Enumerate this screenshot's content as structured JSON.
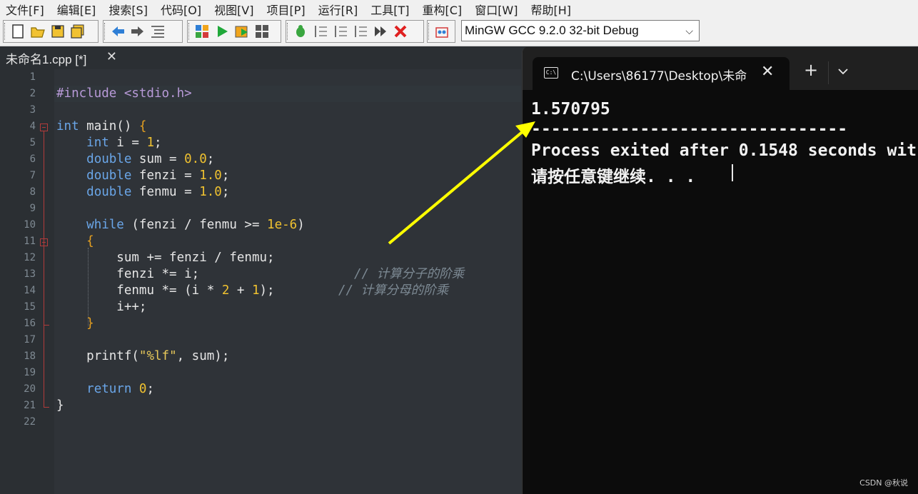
{
  "menu": [
    "文件[F]",
    "编辑[E]",
    "搜索[S]",
    "代码[O]",
    "视图[V]",
    "项目[P]",
    "运行[R]",
    "工具[T]",
    "重构[C]",
    "窗口[W]",
    "帮助[H]"
  ],
  "toolbar": {
    "compiler": "MinGW GCC 9.2.0 32-bit Debug"
  },
  "editor": {
    "tab_title": "未命名1.cpp [*]",
    "tab_close": "✕",
    "line_numbers": [
      "1",
      "2",
      "3",
      "4",
      "5",
      "6",
      "7",
      "8",
      "9",
      "10",
      "11",
      "12",
      "13",
      "14",
      "15",
      "16",
      "17",
      "18",
      "19",
      "20",
      "21",
      "22"
    ],
    "code": {
      "l2_pp": "#include <stdio.h>",
      "l4_kw": "int",
      "l4_rest": " main() ",
      "l4_brace": "{",
      "l5_kw": "int",
      "l5_rest": " i = ",
      "l5_num": "1",
      "l5_end": ";",
      "l6_kw": "double",
      "l6_rest": " sum = ",
      "l6_num": "0.0",
      "l6_end": ";",
      "l7_kw": "double",
      "l7_rest": " fenzi = ",
      "l7_num": "1.0",
      "l7_end": ";",
      "l8_kw": "double",
      "l8_rest": " fenmu = ",
      "l8_num": "1.0",
      "l8_end": ";",
      "l10_kw": "while",
      "l10_rest": " (fenzi / fenmu >= ",
      "l10_num": "1e-6",
      "l10_end": ")",
      "l11_brace": "{",
      "l12": "sum += fenzi / fenmu;",
      "l13": "fenzi *= i;",
      "l13_cmt": "// 计算分子的阶乘",
      "l14_a": "fenmu *= (i * ",
      "l14_num1": "2",
      "l14_b": " + ",
      "l14_num2": "1",
      "l14_c": ");",
      "l14_cmt": "// 计算分母的阶乘",
      "l15": "i++;",
      "l16_brace": "}",
      "l18_a": "printf(",
      "l18_str": "\"%lf\"",
      "l18_b": ", sum);",
      "l20_kw": "return",
      "l20_num": "0",
      "l20_end": ";",
      "l21": "}"
    }
  },
  "terminal": {
    "tab_title": "C:\\Users\\86177\\Desktop\\未命",
    "tab_icon_label": "C:\\",
    "close": "✕",
    "new_tab": "+",
    "dropdown": "⌄",
    "output_value": "1.570795",
    "separator": "--------------------------------",
    "process_line": "Process exited after 0.1548 seconds wit",
    "prompt": "请按任意键继续. . ."
  },
  "watermark": "CSDN @秋说",
  "colors": {
    "arrow": "#ffff00",
    "editor_bg": "#2f3338",
    "keyword": "#6aa6e8",
    "number": "#f0c230",
    "terminal_bg": "#0c0c0c"
  }
}
